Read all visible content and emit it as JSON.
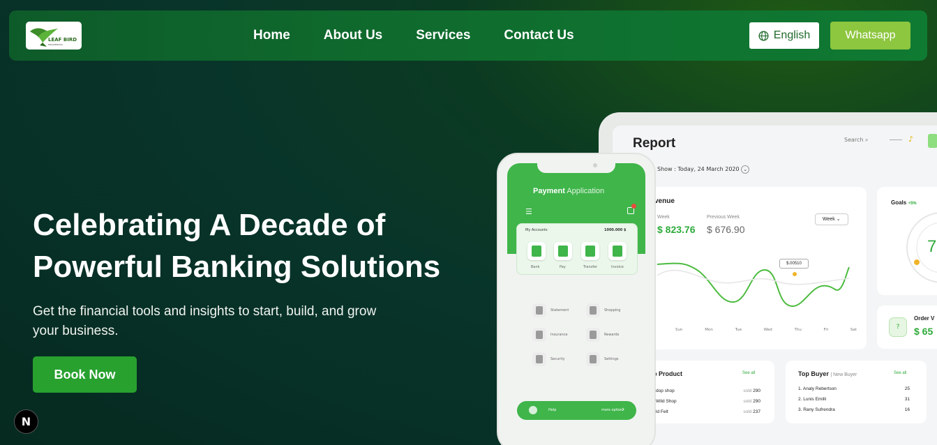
{
  "nav": {
    "logo_text": "LEAF BIRD",
    "logo_sub": "ENGINEERING",
    "items": [
      {
        "label": "Home"
      },
      {
        "label": "About Us"
      },
      {
        "label": "Services"
      },
      {
        "label": "Contact Us"
      }
    ],
    "language": "English",
    "whatsapp": "Whatsapp"
  },
  "hero": {
    "title": "Celebrating A Decade of Powerful Banking Solutions",
    "subtitle": "Get the financial tools and insights to start, build, and grow your business.",
    "cta": "Book Now"
  },
  "badge": "N",
  "dashboard": {
    "title": "Report",
    "search": "Search",
    "date": "Show : Today, 24 March 2020",
    "revenue_title": "venue",
    "this_week_label": "Week",
    "this_week_value": "$ 823.76",
    "prev_week_label": "Previous Week",
    "prev_week_value": "$ 676.90",
    "period": "Week",
    "tooltip": "$.00510",
    "days": [
      "Sun",
      "Mon",
      "Tue",
      "Wed",
      "Thu",
      "Fri",
      "Sat"
    ],
    "goals": "Goals",
    "goals_pct": "+5%",
    "goals_value": "7",
    "order_label": "Order V",
    "order_value": "$ 65",
    "product_title": "p Product",
    "product_seeall": "See all",
    "products": [
      {
        "name": "dop shop",
        "unit": "sold",
        "qty": "290"
      },
      {
        "name": "Wild Shop",
        "unit": "sold",
        "qty": "290"
      },
      {
        "name": "ld Felt",
        "unit": "sold",
        "qty": "237"
      }
    ],
    "buyer_title": "Top Buyer",
    "buyer_tab": "New Buyer",
    "buyer_seeall": "See all",
    "buyers": [
      {
        "name": "1. Analy Rebertson",
        "qty": "25"
      },
      {
        "name": "2. Lunis Emilli",
        "qty": "31"
      },
      {
        "name": "3. Rany Sufrendra",
        "qty": "16"
      }
    ]
  },
  "phone": {
    "title_bold": "Payment",
    "title_light": "Application",
    "account_label": "My Accounts",
    "account_value": "1000.000 $",
    "quick": [
      "Bank",
      "Pay",
      "Transfer",
      "Invoice"
    ],
    "menu": [
      "Statement",
      "Shopping",
      "Insurance",
      "Rewards",
      "Security",
      "Settings"
    ],
    "help": "Help",
    "help_more": "more option"
  },
  "colors": {
    "accent_green": "#28a12f",
    "whatsapp_green": "#8dc63f",
    "nav_green": "#0f6a2d"
  }
}
